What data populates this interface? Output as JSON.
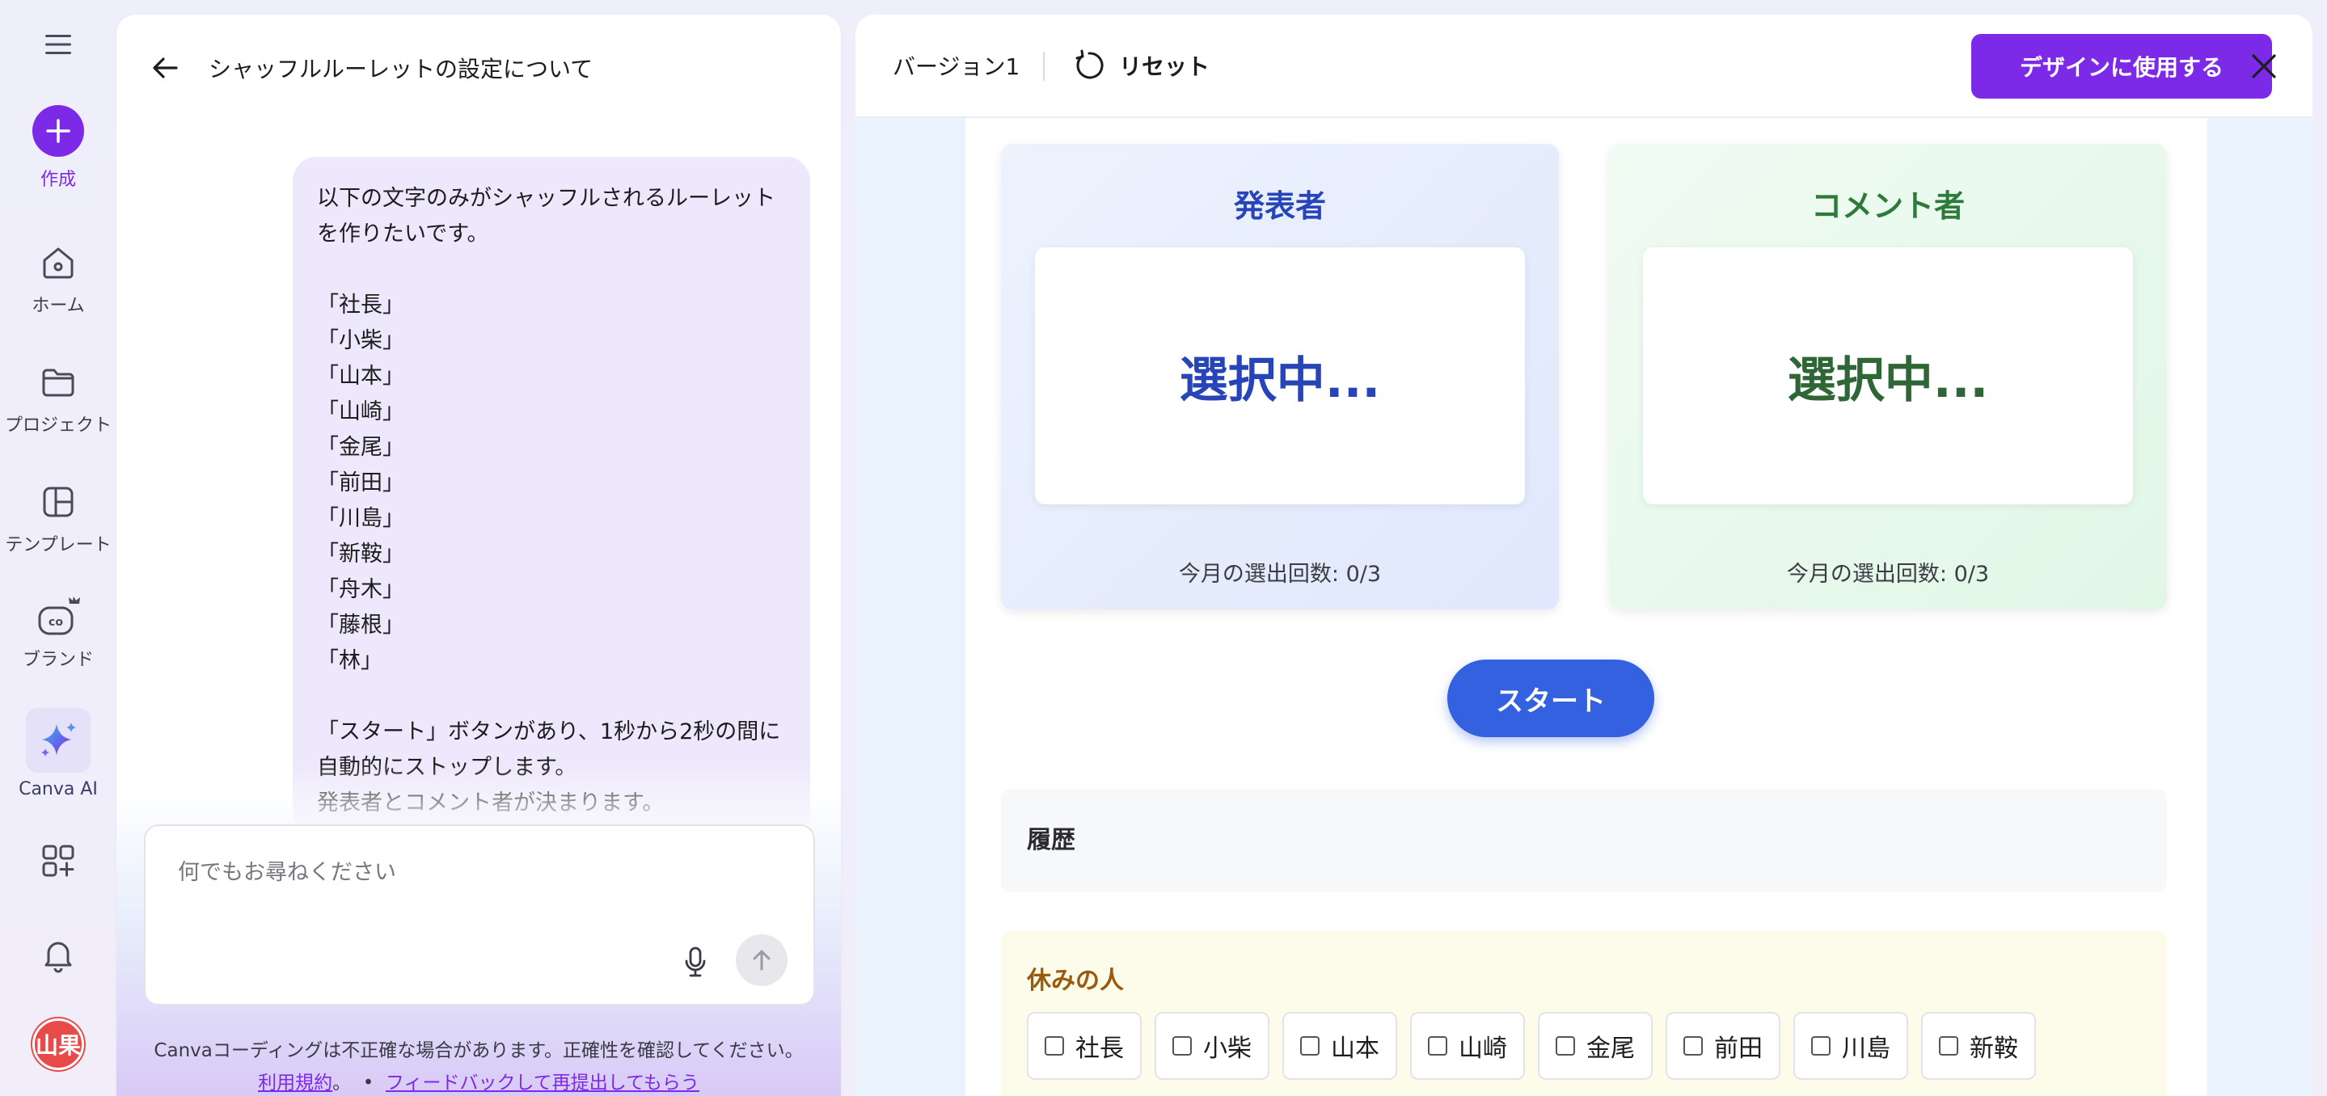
{
  "rail": {
    "create_label": "作成",
    "items": [
      {
        "label": "ホーム",
        "icon": "home-icon"
      },
      {
        "label": "プロジェクト",
        "icon": "folder-icon"
      },
      {
        "label": "テンプレート",
        "icon": "template-icon"
      },
      {
        "label": "ブランド",
        "icon": "brand-icon"
      },
      {
        "label": "Canva AI",
        "icon": "sparkle-icon"
      }
    ],
    "avatar_text": "山果",
    "accent_color": "#7d2ae8"
  },
  "chat": {
    "title": "シャッフルルーレットの設定について",
    "message": "以下の文字のみがシャッフルされるルーレットを作りたいです。\n\n「社長」\n「小柴」\n「山本」\n「山崎」\n「金尾」\n「前田」\n「川島」\n「新鞍」\n「舟木」\n「藤根」\n「林」\n\n「スタート」ボタンがあり、1秒から2秒の間に自動的にストップします。\n発表者とコメント者が決まります。",
    "input_placeholder": "何でもお尋ねください",
    "disclaimer": "Canvaコーディングは不正確な場合があります。正確性を確認してください。",
    "terms_link": "利用規約",
    "terms_suffix": "。",
    "separator": "•",
    "feedback_link": "フィードバックして再提出してもらう"
  },
  "preview": {
    "version": "バージョン1",
    "reset_label": "リセット",
    "use_button": "デザインに使用する",
    "presenter": {
      "title": "発表者",
      "status": "選択中...",
      "count": "今月の選出回数: 0/3",
      "color": "#2745b8"
    },
    "commenter": {
      "title": "コメント者",
      "status": "選択中...",
      "count": "今月の選出回数: 0/3",
      "color": "#2e7a3b"
    },
    "start_button": "スタート",
    "history_title": "履歴",
    "rest_title": "休みの人",
    "rest_people": [
      "社長",
      "小柴",
      "山本",
      "山崎",
      "金尾",
      "前田",
      "川島",
      "新鞍"
    ]
  }
}
